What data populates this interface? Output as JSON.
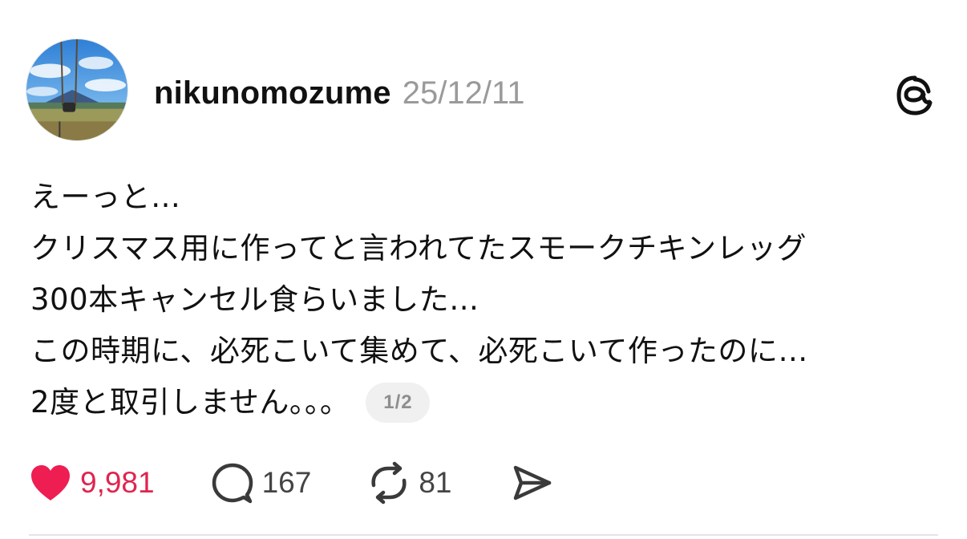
{
  "post": {
    "username": "nikunomozume",
    "timestamp": "25/12/11",
    "avatar_icon": "profile-photo-swing-mountain",
    "brand_icon": "threads-logo-icon",
    "lines": [
      "えーっと…",
      "クリスマス用に作ってと言われてたスモークチキンレッグ",
      "300本キャンセル食らいました…",
      "この時期に、必死こいて集めて、必死こいて作ったのに…",
      "2度と取引しません。。。"
    ],
    "page_indicator": "1/2"
  },
  "actions": {
    "like": {
      "icon": "heart-icon",
      "count": "9,981",
      "liked": true,
      "color": "#e0244f"
    },
    "reply": {
      "icon": "comment-icon",
      "count": "167"
    },
    "repost": {
      "icon": "repost-icon",
      "count": "81"
    },
    "share": {
      "icon": "send-icon"
    }
  }
}
